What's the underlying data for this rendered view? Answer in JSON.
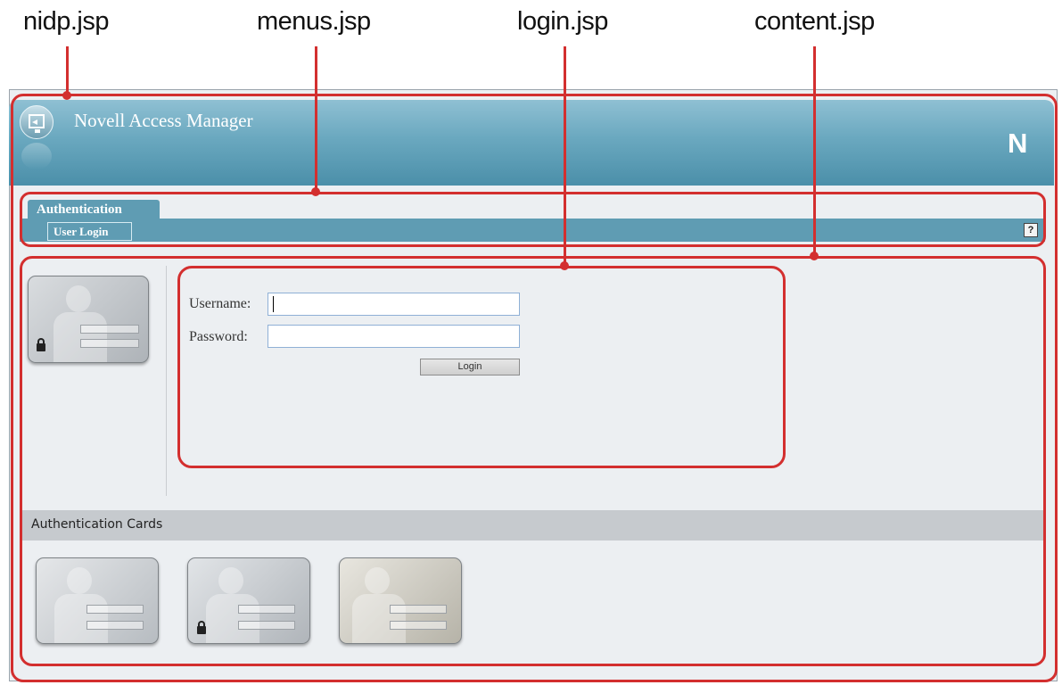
{
  "annotations": {
    "nidp": "nidp.jsp",
    "menus": "menus.jsp",
    "login": "login.jsp",
    "content": "content.jsp"
  },
  "header": {
    "title": "Novell Access Manager",
    "brand": "N"
  },
  "menu": {
    "tab_label": "Authentication",
    "subtab_label": "User Login",
    "help_label": "?"
  },
  "login_form": {
    "username_label": "Username:",
    "password_label": "Password:",
    "username_value": "",
    "password_value": "",
    "button_label": "Login"
  },
  "cards_section": {
    "title": "Authentication Cards"
  },
  "colors": {
    "annotation": "#d32f2f",
    "banner": "#5f9cb3"
  }
}
